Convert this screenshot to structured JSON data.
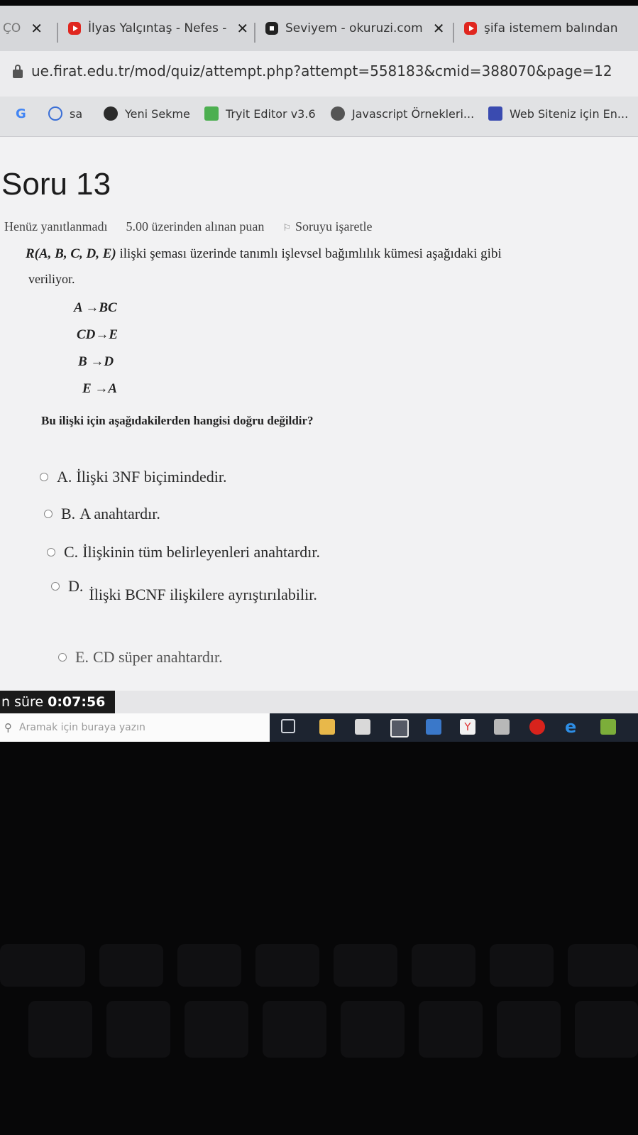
{
  "browser": {
    "tabs": [
      {
        "label": "ÇO",
        "icon": "tab-partial-icon"
      },
      {
        "label": "İlyas Yalçıntaş - Nefes -",
        "icon": "youtube-icon"
      },
      {
        "label": "Seviyem - okuruzi.com",
        "icon": "site-square-icon"
      },
      {
        "label": "şifa istemem balından",
        "icon": "youtube-icon"
      }
    ],
    "close_glyph": "✕",
    "url": "ue.firat.edu.tr/mod/quiz/attempt.php?attempt=558183&cmid=388070&page=12",
    "bookmarks": [
      {
        "label": "",
        "icon": "google-icon"
      },
      {
        "label": "sa",
        "icon": "history-icon"
      },
      {
        "label": "Yeni Sekme",
        "icon": "chrome-icon"
      },
      {
        "label": "Tryit Editor v3.6",
        "icon": "w3schools-icon"
      },
      {
        "label": "Javascript Örnekleri...",
        "icon": "wordpress-icon"
      },
      {
        "label": "Web Siteniz için En...",
        "icon": "site-logo-icon"
      }
    ]
  },
  "quiz": {
    "title": "Soru 13",
    "status": "Henüz yanıtlanmadı",
    "points": "5.00 üzerinden alınan puan",
    "flag_label": "Soruyu işaretle",
    "question_head": "R(A, B, C, D, E)",
    "question_rest": " ilişki şeması üzerinde tanımlı işlevsel bağımlılık kümesi aşağıdaki gibi",
    "question_line2": "veriliyor.",
    "dependencies": [
      "A →BC",
      "CD→E",
      "B →D",
      "E →A"
    ],
    "prompt": "Bu ilişki için aşağıdakilerden hangisi doğru değildir?",
    "options": [
      {
        "letter": "A.",
        "text": "İlişki 3NF biçimindedir."
      },
      {
        "letter": "B.",
        "text": "A anahtardır."
      },
      {
        "letter": "C.",
        "text": "İlişkinin tüm belirleyenleri anahtardır."
      },
      {
        "letter": "D.",
        "text": "İlişki BCNF ilişkilere ayrıştırılabilir."
      },
      {
        "letter": "E.",
        "text": "CD süper anahtardır."
      }
    ],
    "timer_label": "n süre",
    "timer_value": "0:07:56"
  },
  "taskbar": {
    "search_placeholder": "Aramak için buraya yazın",
    "apps": [
      "task-view-icon",
      "file-explorer-icon",
      "store-icon",
      "calculator-icon",
      "mail-icon",
      "yandex-icon",
      "paint-icon",
      "opera-icon",
      "edge-icon",
      "photos-icon"
    ]
  },
  "colors": {
    "youtube": "#e0261f",
    "taskbar": "#1d2430",
    "timer_bg": "#1a1a1a"
  }
}
